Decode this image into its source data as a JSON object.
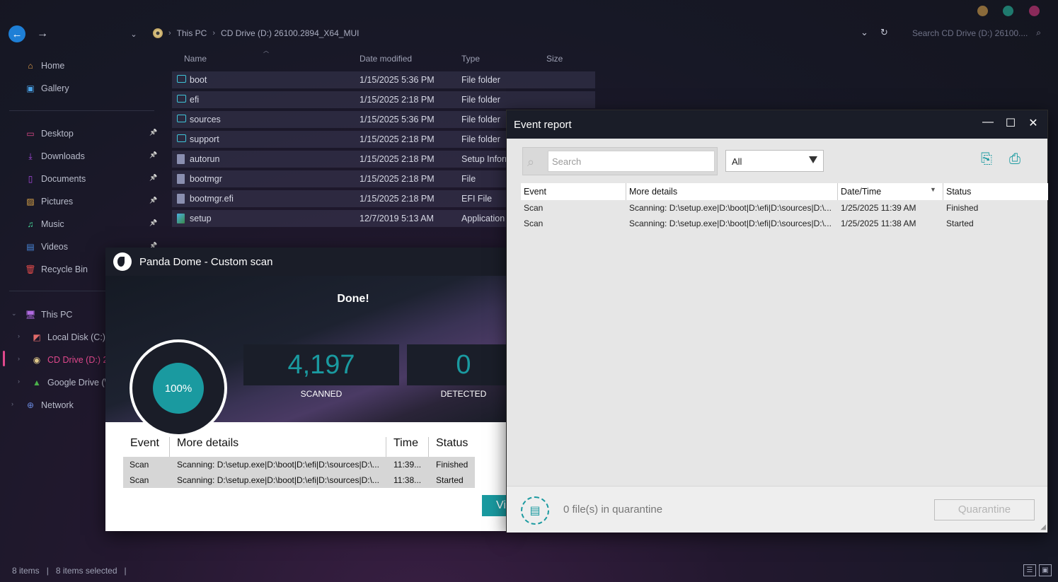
{
  "explorer": {
    "window_controls": [
      {
        "name": "minimize",
        "color": "#8a6a3a"
      },
      {
        "name": "maximize",
        "color": "#1f7a6e"
      },
      {
        "name": "close",
        "color": "#8a2a5a"
      }
    ],
    "nav": {
      "back": "←",
      "forward": "→",
      "recent": "⌄",
      "dropdown": "⌄",
      "refresh": "↻"
    },
    "breadcrumb": [
      "This PC",
      "CD Drive (D:) 26100.2894_X64_MUI"
    ],
    "search_placeholder": "Search CD Drive (D:) 26100....",
    "sidebar": {
      "top": [
        {
          "label": "Home",
          "icon": "home-icon",
          "glyph": "⌂",
          "color": "#e8a24a"
        },
        {
          "label": "Gallery",
          "icon": "gallery-icon",
          "glyph": "▣",
          "color": "#4aa3e8"
        }
      ],
      "pinned": [
        {
          "label": "Desktop",
          "icon": "desktop-icon",
          "glyph": "▭",
          "color": "#e04a8a"
        },
        {
          "label": "Downloads",
          "icon": "download-icon",
          "glyph": "⤓",
          "color": "#a84ae0"
        },
        {
          "label": "Documents",
          "icon": "documents-icon",
          "glyph": "▯",
          "color": "#a84ae0"
        },
        {
          "label": "Pictures",
          "icon": "pictures-icon",
          "glyph": "▨",
          "color": "#e0a84a"
        },
        {
          "label": "Music",
          "icon": "music-icon",
          "glyph": "♫",
          "color": "#4ae0a0"
        },
        {
          "label": "Videos",
          "icon": "videos-icon",
          "glyph": "▤",
          "color": "#4a8ae0"
        },
        {
          "label": "Recycle Bin",
          "icon": "recycle-bin-icon",
          "glyph": "🗑",
          "color": "#e04a4a"
        }
      ],
      "tree": [
        {
          "label": "This PC",
          "icon": "pc-icon",
          "glyph": "🖥",
          "color": "#b06ae0"
        },
        {
          "label": "Local Disk (C:)",
          "icon": "disk-icon",
          "glyph": "◩",
          "color": "#e06a6a"
        },
        {
          "label": "CD Drive (D:) 26",
          "icon": "cd-drive-icon",
          "glyph": "◉",
          "color": "#e0c98a"
        },
        {
          "label": "Google Drive (\\\\",
          "icon": "google-drive-icon",
          "glyph": "▲",
          "color": "#4ab04a"
        },
        {
          "label": "Network",
          "icon": "network-icon",
          "glyph": "⊕",
          "color": "#6a8ae0"
        }
      ]
    },
    "columns": {
      "name": "Name",
      "date": "Date modified",
      "type": "Type",
      "size": "Size"
    },
    "files": [
      {
        "name": "boot",
        "date": "1/15/2025 5:36 PM",
        "type": "File folder",
        "kind": "folder"
      },
      {
        "name": "efi",
        "date": "1/15/2025 2:18 PM",
        "type": "File folder",
        "kind": "folder"
      },
      {
        "name": "sources",
        "date": "1/15/2025 5:36 PM",
        "type": "File folder",
        "kind": "folder"
      },
      {
        "name": "support",
        "date": "1/15/2025 2:18 PM",
        "type": "File folder",
        "kind": "folder"
      },
      {
        "name": "autorun",
        "date": "1/15/2025 2:18 PM",
        "type": "Setup Inforn",
        "kind": "file"
      },
      {
        "name": "bootmgr",
        "date": "1/15/2025 2:18 PM",
        "type": "File",
        "kind": "file"
      },
      {
        "name": "bootmgr.efi",
        "date": "1/15/2025 2:18 PM",
        "type": "EFI File",
        "kind": "file"
      },
      {
        "name": "setup",
        "date": "12/7/2019 5:13 AM",
        "type": "Application",
        "kind": "app"
      }
    ],
    "status": {
      "items": "8 items",
      "selected": "8 items selected"
    }
  },
  "panda": {
    "title": "Panda Dome - Custom scan",
    "done": "Done!",
    "progress": "100%",
    "progress_fraction": 1.0,
    "scanned_value": "4,197",
    "scanned_label": "SCANNED",
    "detected_value": "0",
    "detected_label": "DETECTED",
    "table_headers": {
      "event": "Event",
      "details": "More details",
      "time": "Time",
      "status": "Status"
    },
    "rows": [
      {
        "event": "Scan",
        "details": "Scanning: D:\\setup.exe|D:\\boot|D:\\efi|D:\\sources|D:\\...",
        "time": "11:39...",
        "status": "Finished"
      },
      {
        "event": "Scan",
        "details": "Scanning: D:\\setup.exe|D:\\boot|D:\\efi|D:\\sources|D:\\...",
        "time": "11:38...",
        "status": "Started"
      }
    ],
    "view_button": "Vi",
    "accent": "#1a9aa0"
  },
  "event_report": {
    "title": "Event report",
    "search_placeholder": "Search",
    "filter_value": "All",
    "table_headers": {
      "event": "Event",
      "details": "More details",
      "datetime": "Date/Time",
      "status": "Status"
    },
    "rows": [
      {
        "event": "Scan",
        "details": "Scanning: D:\\setup.exe|D:\\boot|D:\\efi|D:\\sources|D:\\...",
        "datetime": "1/25/2025 11:39 AM",
        "status": "Finished"
      },
      {
        "event": "Scan",
        "details": "Scanning: D:\\setup.exe|D:\\boot|D:\\efi|D:\\sources|D:\\...",
        "datetime": "1/25/2025 11:38 AM",
        "status": "Started"
      }
    ],
    "quarantine_text": "0 file(s) in quarantine",
    "quarantine_button": "Quarantine"
  }
}
